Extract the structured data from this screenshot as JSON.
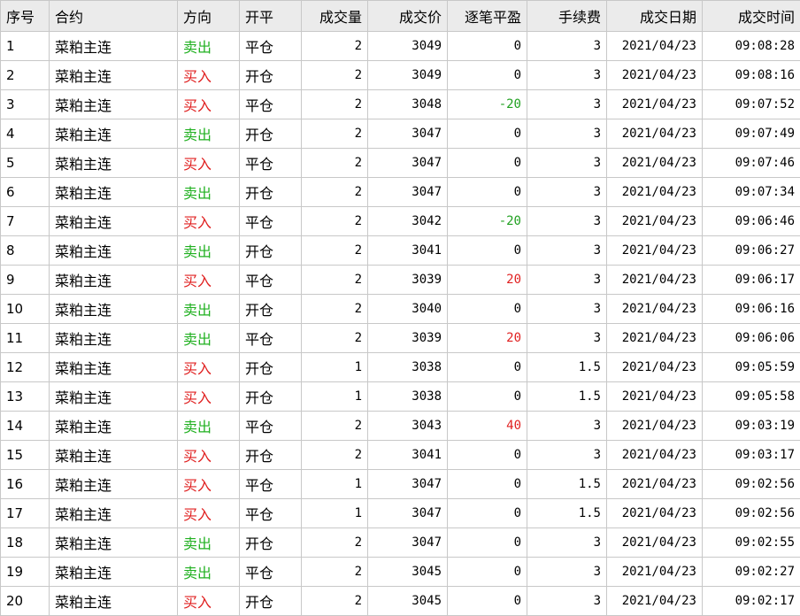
{
  "headers": [
    "序号",
    "合约",
    "方向",
    "开平",
    "成交量",
    "成交价",
    "逐笔平盈",
    "手续费",
    "成交日期",
    "成交时间"
  ],
  "colors": {
    "buy": "#e02020",
    "sell": "#20b020",
    "profit": "#e02020",
    "loss": "#20a020"
  },
  "rows": [
    {
      "seq": "1",
      "contract": "菜粕主连",
      "side": "卖出",
      "side_type": "sell",
      "openclose": "平仓",
      "volume": "2",
      "price": "3049",
      "pnl": "0",
      "fee": "3",
      "date": "2021/04/23",
      "time": "09:08:28"
    },
    {
      "seq": "2",
      "contract": "菜粕主连",
      "side": "买入",
      "side_type": "buy",
      "openclose": "开仓",
      "volume": "2",
      "price": "3049",
      "pnl": "0",
      "fee": "3",
      "date": "2021/04/23",
      "time": "09:08:16"
    },
    {
      "seq": "3",
      "contract": "菜粕主连",
      "side": "买入",
      "side_type": "buy",
      "openclose": "平仓",
      "volume": "2",
      "price": "3048",
      "pnl": "-20",
      "fee": "3",
      "date": "2021/04/23",
      "time": "09:07:52"
    },
    {
      "seq": "4",
      "contract": "菜粕主连",
      "side": "卖出",
      "side_type": "sell",
      "openclose": "开仓",
      "volume": "2",
      "price": "3047",
      "pnl": "0",
      "fee": "3",
      "date": "2021/04/23",
      "time": "09:07:49"
    },
    {
      "seq": "5",
      "contract": "菜粕主连",
      "side": "买入",
      "side_type": "buy",
      "openclose": "平仓",
      "volume": "2",
      "price": "3047",
      "pnl": "0",
      "fee": "3",
      "date": "2021/04/23",
      "time": "09:07:46"
    },
    {
      "seq": "6",
      "contract": "菜粕主连",
      "side": "卖出",
      "side_type": "sell",
      "openclose": "开仓",
      "volume": "2",
      "price": "3047",
      "pnl": "0",
      "fee": "3",
      "date": "2021/04/23",
      "time": "09:07:34"
    },
    {
      "seq": "7",
      "contract": "菜粕主连",
      "side": "买入",
      "side_type": "buy",
      "openclose": "平仓",
      "volume": "2",
      "price": "3042",
      "pnl": "-20",
      "fee": "3",
      "date": "2021/04/23",
      "time": "09:06:46"
    },
    {
      "seq": "8",
      "contract": "菜粕主连",
      "side": "卖出",
      "side_type": "sell",
      "openclose": "开仓",
      "volume": "2",
      "price": "3041",
      "pnl": "0",
      "fee": "3",
      "date": "2021/04/23",
      "time": "09:06:27"
    },
    {
      "seq": "9",
      "contract": "菜粕主连",
      "side": "买入",
      "side_type": "buy",
      "openclose": "平仓",
      "volume": "2",
      "price": "3039",
      "pnl": "20",
      "fee": "3",
      "date": "2021/04/23",
      "time": "09:06:17"
    },
    {
      "seq": "10",
      "contract": "菜粕主连",
      "side": "卖出",
      "side_type": "sell",
      "openclose": "开仓",
      "volume": "2",
      "price": "3040",
      "pnl": "0",
      "fee": "3",
      "date": "2021/04/23",
      "time": "09:06:16"
    },
    {
      "seq": "11",
      "contract": "菜粕主连",
      "side": "卖出",
      "side_type": "sell",
      "openclose": "平仓",
      "volume": "2",
      "price": "3039",
      "pnl": "20",
      "fee": "3",
      "date": "2021/04/23",
      "time": "09:06:06"
    },
    {
      "seq": "12",
      "contract": "菜粕主连",
      "side": "买入",
      "side_type": "buy",
      "openclose": "开仓",
      "volume": "1",
      "price": "3038",
      "pnl": "0",
      "fee": "1.5",
      "date": "2021/04/23",
      "time": "09:05:59"
    },
    {
      "seq": "13",
      "contract": "菜粕主连",
      "side": "买入",
      "side_type": "buy",
      "openclose": "开仓",
      "volume": "1",
      "price": "3038",
      "pnl": "0",
      "fee": "1.5",
      "date": "2021/04/23",
      "time": "09:05:58"
    },
    {
      "seq": "14",
      "contract": "菜粕主连",
      "side": "卖出",
      "side_type": "sell",
      "openclose": "平仓",
      "volume": "2",
      "price": "3043",
      "pnl": "40",
      "fee": "3",
      "date": "2021/04/23",
      "time": "09:03:19"
    },
    {
      "seq": "15",
      "contract": "菜粕主连",
      "side": "买入",
      "side_type": "buy",
      "openclose": "开仓",
      "volume": "2",
      "price": "3041",
      "pnl": "0",
      "fee": "3",
      "date": "2021/04/23",
      "time": "09:03:17"
    },
    {
      "seq": "16",
      "contract": "菜粕主连",
      "side": "买入",
      "side_type": "buy",
      "openclose": "平仓",
      "volume": "1",
      "price": "3047",
      "pnl": "0",
      "fee": "1.5",
      "date": "2021/04/23",
      "time": "09:02:56"
    },
    {
      "seq": "17",
      "contract": "菜粕主连",
      "side": "买入",
      "side_type": "buy",
      "openclose": "平仓",
      "volume": "1",
      "price": "3047",
      "pnl": "0",
      "fee": "1.5",
      "date": "2021/04/23",
      "time": "09:02:56"
    },
    {
      "seq": "18",
      "contract": "菜粕主连",
      "side": "卖出",
      "side_type": "sell",
      "openclose": "开仓",
      "volume": "2",
      "price": "3047",
      "pnl": "0",
      "fee": "3",
      "date": "2021/04/23",
      "time": "09:02:55"
    },
    {
      "seq": "19",
      "contract": "菜粕主连",
      "side": "卖出",
      "side_type": "sell",
      "openclose": "平仓",
      "volume": "2",
      "price": "3045",
      "pnl": "0",
      "fee": "3",
      "date": "2021/04/23",
      "time": "09:02:27"
    },
    {
      "seq": "20",
      "contract": "菜粕主连",
      "side": "买入",
      "side_type": "buy",
      "openclose": "开仓",
      "volume": "2",
      "price": "3045",
      "pnl": "0",
      "fee": "3",
      "date": "2021/04/23",
      "time": "09:02:17"
    }
  ]
}
